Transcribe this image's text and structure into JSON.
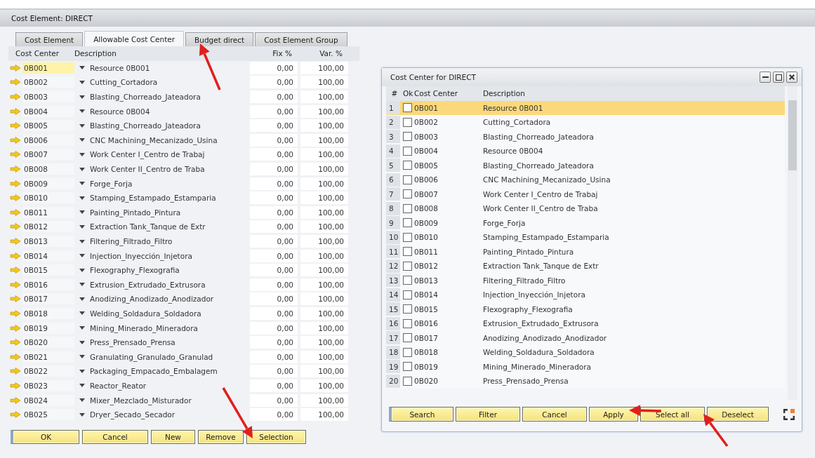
{
  "window": {
    "title": "Cost Element: DIRECT"
  },
  "tabs": [
    {
      "label": "Cost Element",
      "selected": false
    },
    {
      "label": "Allowable Cost Center",
      "selected": true
    },
    {
      "label": "Budget direct",
      "selected": false
    },
    {
      "label": "Cost Element Group",
      "selected": false
    }
  ],
  "table": {
    "columns": [
      "Cost Center",
      "Description",
      "Fix %",
      "Var. %"
    ],
    "rows": [
      {
        "cost_center": "0B001",
        "description": "Resource 0B001",
        "fix": "0,00",
        "var": "100,00",
        "selected": true
      },
      {
        "cost_center": "0B002",
        "description": "Cutting_Cortadora",
        "fix": "0,00",
        "var": "100,00",
        "selected": false
      },
      {
        "cost_center": "0B003",
        "description": "Blasting_Chorreado_Jateadora",
        "fix": "0,00",
        "var": "100,00",
        "selected": false
      },
      {
        "cost_center": "0B004",
        "description": "Resource 0B004",
        "fix": "0,00",
        "var": "100,00",
        "selected": false
      },
      {
        "cost_center": "0B005",
        "description": "Blasting_Chorreado_Jateadora",
        "fix": "0,00",
        "var": "100,00",
        "selected": false
      },
      {
        "cost_center": "0B006",
        "description": "CNC Machining_Mecanizado_Usina",
        "fix": "0,00",
        "var": "100,00",
        "selected": false
      },
      {
        "cost_center": "0B007",
        "description": "Work Center I_Centro de Trabaj",
        "fix": "0,00",
        "var": "100,00",
        "selected": false
      },
      {
        "cost_center": "0B008",
        "description": "Work Center II_Centro de Traba",
        "fix": "0,00",
        "var": "100,00",
        "selected": false
      },
      {
        "cost_center": "0B009",
        "description": "Forge_Forja",
        "fix": "0,00",
        "var": "100,00",
        "selected": false
      },
      {
        "cost_center": "0B010",
        "description": "Stamping_Estampado_Estamparia",
        "fix": "0,00",
        "var": "100,00",
        "selected": false
      },
      {
        "cost_center": "0B011",
        "description": "Painting_Pintado_Pintura",
        "fix": "0,00",
        "var": "100,00",
        "selected": false
      },
      {
        "cost_center": "0B012",
        "description": "Extraction Tank_Tanque de Extr",
        "fix": "0,00",
        "var": "100,00",
        "selected": false
      },
      {
        "cost_center": "0B013",
        "description": "Filtering_Filtrado_Filtro",
        "fix": "0,00",
        "var": "100,00",
        "selected": false
      },
      {
        "cost_center": "0B014",
        "description": "Injection_Inyección_Injetora",
        "fix": "0,00",
        "var": "100,00",
        "selected": false
      },
      {
        "cost_center": "0B015",
        "description": "Flexography_Flexografia",
        "fix": "0,00",
        "var": "100,00",
        "selected": false
      },
      {
        "cost_center": "0B016",
        "description": "Extrusion_Extrudado_Extrusora",
        "fix": "0,00",
        "var": "100,00",
        "selected": false
      },
      {
        "cost_center": "0B017",
        "description": "Anodizing_Anodizado_Anodizador",
        "fix": "0,00",
        "var": "100,00",
        "selected": false
      },
      {
        "cost_center": "0B018",
        "description": "Welding_Soldadura_Soldadora",
        "fix": "0,00",
        "var": "100,00",
        "selected": false
      },
      {
        "cost_center": "0B019",
        "description": "Mining_Minerado_Mineradora",
        "fix": "0,00",
        "var": "100,00",
        "selected": false
      },
      {
        "cost_center": "0B020",
        "description": "Press_Prensado_Prensa",
        "fix": "0,00",
        "var": "100,00",
        "selected": false
      },
      {
        "cost_center": "0B021",
        "description": "Granulating_Granulado_Granulad",
        "fix": "0,00",
        "var": "100,00",
        "selected": false
      },
      {
        "cost_center": "0B022",
        "description": "Packaging_Empacado_Embalagem",
        "fix": "0,00",
        "var": "100,00",
        "selected": false
      },
      {
        "cost_center": "0B023",
        "description": "Reactor_Reator",
        "fix": "0,00",
        "var": "100,00",
        "selected": false
      },
      {
        "cost_center": "0B024",
        "description": "Mixer_Mezclado_Misturador",
        "fix": "0,00",
        "var": "100,00",
        "selected": false
      },
      {
        "cost_center": "0B025",
        "description": "Dryer_Secado_Secador",
        "fix": "0,00",
        "var": "100,00",
        "selected": false
      }
    ]
  },
  "buttons": [
    "OK",
    "Cancel",
    "New",
    "Remove",
    "Selection"
  ],
  "dialog": {
    "title": "Cost Center for DIRECT",
    "columns": [
      "#",
      "Ok",
      "Cost Center",
      "Description"
    ],
    "rows": [
      {
        "number": "1",
        "checked": false,
        "cost_center": "0B001",
        "description": "Resource 0B001",
        "selected": true
      },
      {
        "number": "2",
        "checked": false,
        "cost_center": "0B002",
        "description": "Cutting_Cortadora",
        "selected": false
      },
      {
        "number": "3",
        "checked": false,
        "cost_center": "0B003",
        "description": "Blasting_Chorreado_Jateadora",
        "selected": false
      },
      {
        "number": "4",
        "checked": false,
        "cost_center": "0B004",
        "description": "Resource 0B004",
        "selected": false
      },
      {
        "number": "5",
        "checked": false,
        "cost_center": "0B005",
        "description": "Blasting_Chorreado_Jateadora",
        "selected": false
      },
      {
        "number": "6",
        "checked": false,
        "cost_center": "0B006",
        "description": "CNC Machining_Mecanizado_Usina",
        "selected": false
      },
      {
        "number": "7",
        "checked": false,
        "cost_center": "0B007",
        "description": "Work Center I_Centro de Trabaj",
        "selected": false
      },
      {
        "number": "8",
        "checked": false,
        "cost_center": "0B008",
        "description": "Work Center II_Centro de Traba",
        "selected": false
      },
      {
        "number": "9",
        "checked": false,
        "cost_center": "0B009",
        "description": "Forge_Forja",
        "selected": false
      },
      {
        "number": "10",
        "checked": false,
        "cost_center": "0B010",
        "description": "Stamping_Estampado_Estamparia",
        "selected": false
      },
      {
        "number": "11",
        "checked": false,
        "cost_center": "0B011",
        "description": "Painting_Pintado_Pintura",
        "selected": false
      },
      {
        "number": "12",
        "checked": false,
        "cost_center": "0B012",
        "description": "Extraction Tank_Tanque de Extr",
        "selected": false
      },
      {
        "number": "13",
        "checked": false,
        "cost_center": "0B013",
        "description": "Filtering_Filtrado_Filtro",
        "selected": false
      },
      {
        "number": "14",
        "checked": false,
        "cost_center": "0B014",
        "description": "Injection_Inyección_Injetora",
        "selected": false
      },
      {
        "number": "15",
        "checked": false,
        "cost_center": "0B015",
        "description": "Flexography_Flexografia",
        "selected": false
      },
      {
        "number": "16",
        "checked": false,
        "cost_center": "0B016",
        "description": "Extrusion_Extrudado_Extrusora",
        "selected": false
      },
      {
        "number": "17",
        "checked": false,
        "cost_center": "0B017",
        "description": "Anodizing_Anodizado_Anodizador",
        "selected": false
      },
      {
        "number": "18",
        "checked": false,
        "cost_center": "0B018",
        "description": "Welding_Soldadura_Soldadora",
        "selected": false
      },
      {
        "number": "19",
        "checked": false,
        "cost_center": "0B019",
        "description": "Mining_Minerado_Mineradora",
        "selected": false
      },
      {
        "number": "20",
        "checked": false,
        "cost_center": "0B020",
        "description": "Press_Prensado_Prensa",
        "selected": false
      }
    ],
    "buttons": [
      "Search",
      "Filter",
      "Cancel",
      "Apply",
      "Select all",
      "Deselect"
    ]
  }
}
